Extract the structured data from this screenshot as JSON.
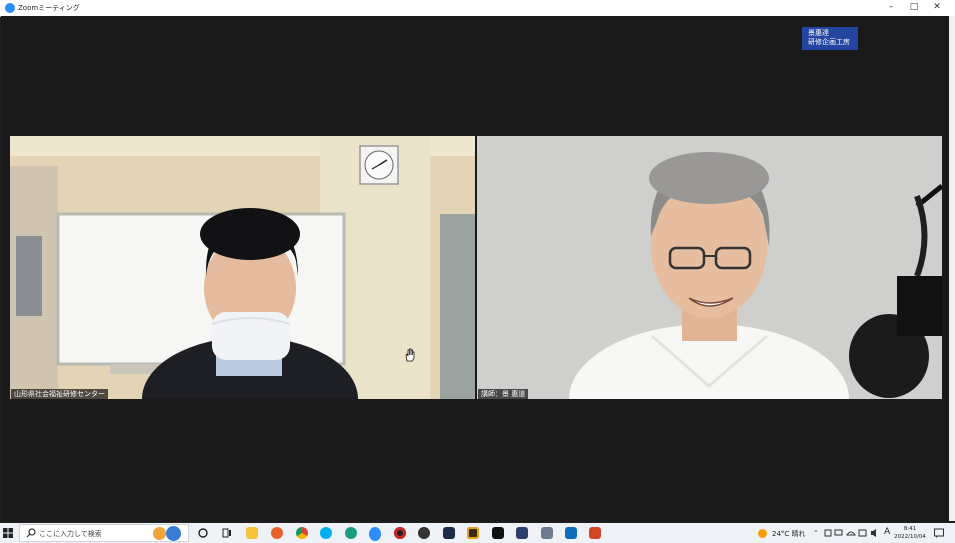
{
  "window": {
    "title": "Zoomミーティング"
  },
  "brand_badge": {
    "line1": "景惠達",
    "line2": "研修企画工房"
  },
  "participants": [
    {
      "name": "山形県社会福祉研修センター"
    },
    {
      "name": "講師：景 惠道"
    }
  ],
  "taskbar": {
    "search_placeholder": "ここに入力して検索",
    "weather": "24°C 晴れ",
    "ime": "A",
    "time": "8:41",
    "date": "2022/10/04"
  },
  "colors": {
    "zoom_blue": "#2d8cff",
    "badge_blue": "#2546a0",
    "background": "#1a1a1a"
  }
}
